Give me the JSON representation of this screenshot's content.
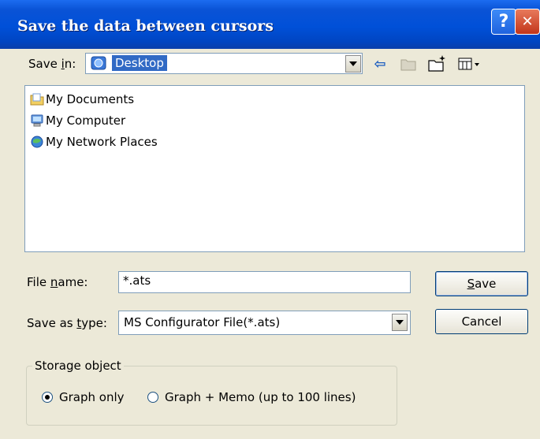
{
  "window": {
    "title": "Save the data between cursors",
    "help_glyph": "?",
    "close_glyph": "✕"
  },
  "save_in": {
    "label_pre": "Save ",
    "label_accel": "i",
    "label_post": "n:",
    "value": "Desktop"
  },
  "toolbar": {
    "icons": [
      "back-arrow-icon",
      "up-folder-icon",
      "new-folder-icon",
      "view-menu-icon"
    ],
    "back_glyph": "⇦"
  },
  "file_list": {
    "items": [
      {
        "label": "My Documents",
        "icon": "my-documents-icon"
      },
      {
        "label": "My Computer",
        "icon": "my-computer-icon"
      },
      {
        "label": "My Network Places",
        "icon": "my-network-places-icon"
      }
    ]
  },
  "file_name": {
    "label_pre": "File ",
    "label_accel": "n",
    "label_post": "ame:",
    "value": "*.ats"
  },
  "save_type": {
    "label_pre": "Save as ",
    "label_accel": "t",
    "label_post": "ype:",
    "value": "MS Configurator File(*.ats)"
  },
  "buttons": {
    "save_accel": "S",
    "save_rest": "ave",
    "cancel": "Cancel"
  },
  "storage": {
    "legend": "Storage object",
    "options": [
      {
        "label": "Graph only",
        "checked": true
      },
      {
        "label": "Graph + Memo (up to 100 lines)",
        "checked": false
      }
    ]
  },
  "colors": {
    "title_bar": "#0050d8",
    "dialog_bg": "#ece9d8",
    "selection": "#316ac5"
  }
}
